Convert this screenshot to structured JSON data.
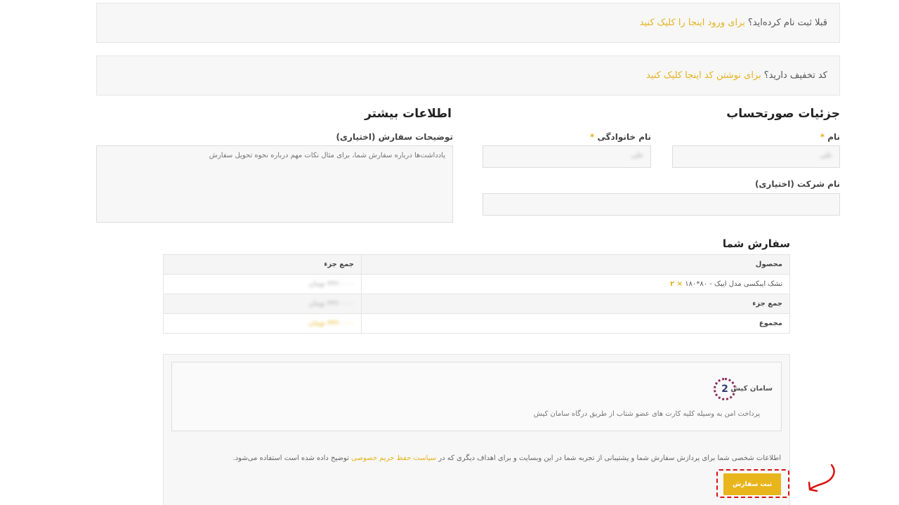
{
  "notices": {
    "login_text": "قبلا ثبت نام کرده‌اید؟",
    "login_link": "برای ورود اینجا را کلیک کنید",
    "coupon_text": "کد تخفیف دارید؟",
    "coupon_link": "برای نوشتن کد اینجا کلیک کنید"
  },
  "billing": {
    "title": "جزئیات صورتحساب",
    "first_name_label": "نام",
    "last_name_label": "نام خانوادگی",
    "required_mark": "*",
    "first_name_value": "علی",
    "last_name_value": "علی",
    "company_label": "نام شرکت (اختیاری)"
  },
  "additional": {
    "title": "اطلاعات بیشتر",
    "notes_label": "توضیحات سفارش (اختیاری)",
    "notes_placeholder": "یادداشت‌ها درباره سفارش شما، برای مثال نکات مهم درباره نحوه تحویل سفارش"
  },
  "order": {
    "title": "سفارش شما",
    "headers": {
      "product": "محصول",
      "subtotal": "جمع جزء"
    },
    "item_name": "تشک ایبکسی مدل ایبک - ۸۰*۱۸۰",
    "item_qty": "× ۲",
    "item_price": "۴۴۲۰۰۰۰ تومان",
    "subtotal_label": "جمع جزء",
    "subtotal_value": "۴۴۲۰۰۰۰ تومان",
    "total_label": "مجموع",
    "total_value": "۴۴۲۰۰۰۰ تومان"
  },
  "payment": {
    "gateway_name": "سامان کیش",
    "gateway_logo_glyph": "2",
    "gateway_desc": "پرداخت امن به وسیله کلیه کارت های عضو شتاب از طریق درگاه سامان کیش",
    "privacy_text_1": "اطلاعات شخصی شما برای پردازش سفارش شما و پشتیبانی از تجربه شما در این وبسایت و برای اهداف دیگری که در",
    "privacy_link": "سیاست حفظ حریم خصوصی",
    "privacy_text_2": "توضیح داده شده است استفاده می‌شود.",
    "submit_label": "ثبت سفارش"
  },
  "colors": {
    "accent": "#e8b51c",
    "highlight": "#dd1111"
  },
  "icons": {
    "annotation_arrow": "curved-arrow-icon"
  }
}
